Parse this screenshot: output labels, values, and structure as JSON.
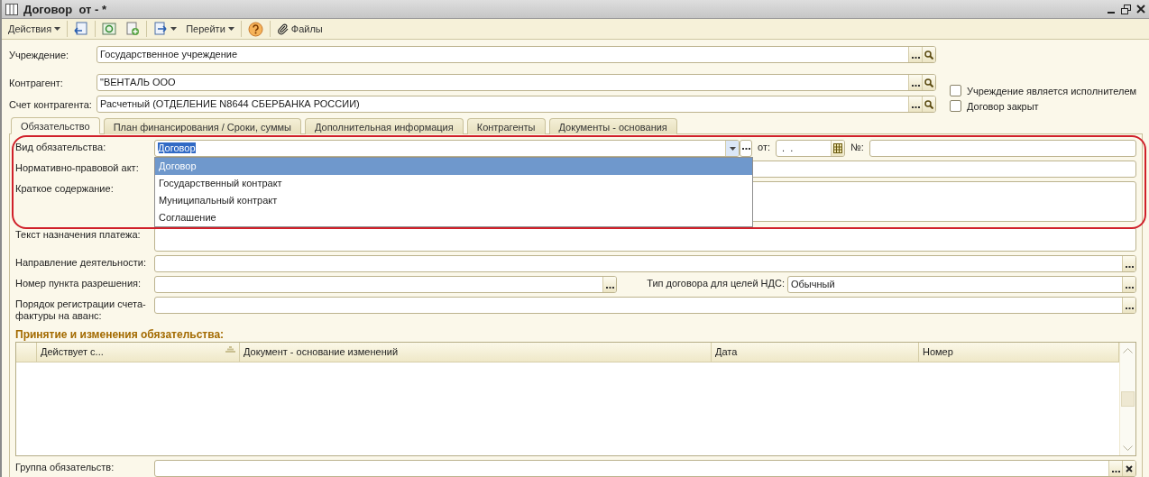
{
  "window": {
    "title": "Договор  от - *"
  },
  "toolbar": {
    "actions_menu": "Действия",
    "goto_menu": "Перейти",
    "files_button": "Файлы"
  },
  "header_fields": [
    {
      "label": "Учреждение:",
      "value": "Государственное учреждение"
    },
    {
      "label": "Контрагент:",
      "value": "\"ВЕНТАЛЬ ООО"
    },
    {
      "label": "Счет контрагента:",
      "value": "Расчетный (ОТДЕЛЕНИЕ N8644 СБЕРБАНКА РОССИИ)"
    }
  ],
  "checkboxes": [
    {
      "label": "Учреждение является исполнителем",
      "checked": false
    },
    {
      "label": "Договор закрыт",
      "checked": false
    }
  ],
  "tabs": [
    {
      "label": "Обязательство",
      "selected": true
    },
    {
      "label": "План финансирования / Сроки, суммы",
      "selected": false
    },
    {
      "label": "Дополнительная информация",
      "selected": false
    },
    {
      "label": "Контрагенты",
      "selected": false
    },
    {
      "label": "Документы - основания",
      "selected": false
    }
  ],
  "obligation": {
    "type_label": "Вид обязательства:",
    "type_value": "Договор",
    "date_label": "от:",
    "date_value": " .  .",
    "number_label": "№:"
  },
  "dropdown": {
    "options": [
      {
        "label": "Договор",
        "selected": true
      },
      {
        "label": "Государственный контракт",
        "selected": false
      },
      {
        "label": "Муниципальный контракт",
        "selected": false
      },
      {
        "label": "Соглашение",
        "selected": false
      }
    ]
  },
  "form_rows": [
    {
      "kind": "line",
      "label": "Нормативно-правовой акт:"
    },
    {
      "kind": "area",
      "label": "Краткое содержание:"
    },
    {
      "kind": "area",
      "label": "Текст назначения платежа:"
    },
    {
      "kind": "choice",
      "label": "Направление деятельности:"
    },
    {
      "kind": "pair",
      "label": "Номер пункта разрешения:",
      "label_2": "Тип договора для целей НДС:",
      "value_2": "Обычный"
    },
    {
      "kind": "choice",
      "label": "Порядок регистрации счета-фактуры на аванс:"
    }
  ],
  "table": {
    "title": "Принятие и изменения обязательства:",
    "columns": [
      "Действует с...",
      "Документ - основание изменений",
      "Дата",
      "Номер"
    ]
  },
  "group_field": {
    "label": "Группа обязательств:"
  }
}
